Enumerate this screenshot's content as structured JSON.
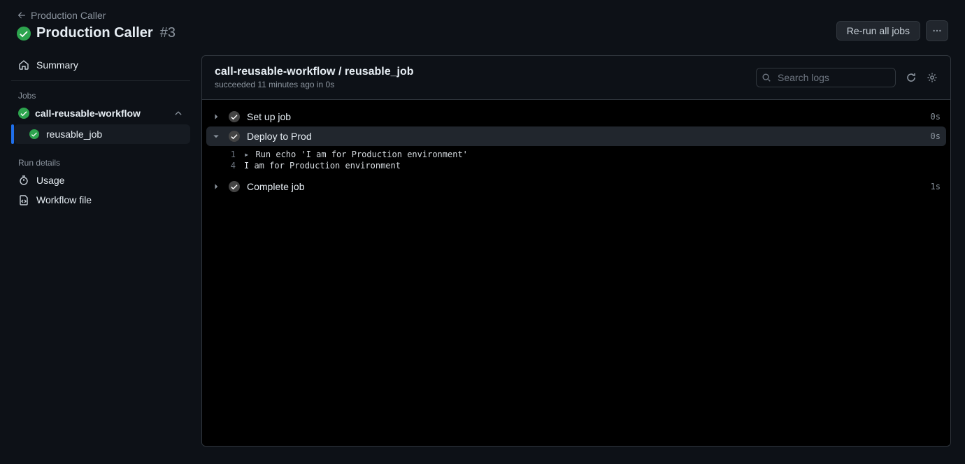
{
  "breadcrumb": {
    "back_label": "Production Caller"
  },
  "title": {
    "name": "Production Caller",
    "number": "#3"
  },
  "actions": {
    "rerun": "Re-run all jobs"
  },
  "sidebar": {
    "summary": "Summary",
    "jobs_heading": "Jobs",
    "workflow_name": "call-reusable-workflow",
    "job_name": "reusable_job",
    "run_details_heading": "Run details",
    "usage": "Usage",
    "workflow_file": "Workflow file"
  },
  "panel": {
    "title": "call-reusable-workflow / reusable_job",
    "subtitle": "succeeded 11 minutes ago in 0s",
    "search_placeholder": "Search logs"
  },
  "steps": [
    {
      "name": "Set up job",
      "time": "0s",
      "expanded": false
    },
    {
      "name": "Deploy to Prod",
      "time": "0s",
      "expanded": true,
      "lines": [
        {
          "n": "1",
          "prefix": "▸",
          "text": "Run echo 'I am for Production environment'"
        },
        {
          "n": "4",
          "prefix": "",
          "text": "I am for Production environment"
        }
      ]
    },
    {
      "name": "Complete job",
      "time": "1s",
      "expanded": false
    }
  ]
}
